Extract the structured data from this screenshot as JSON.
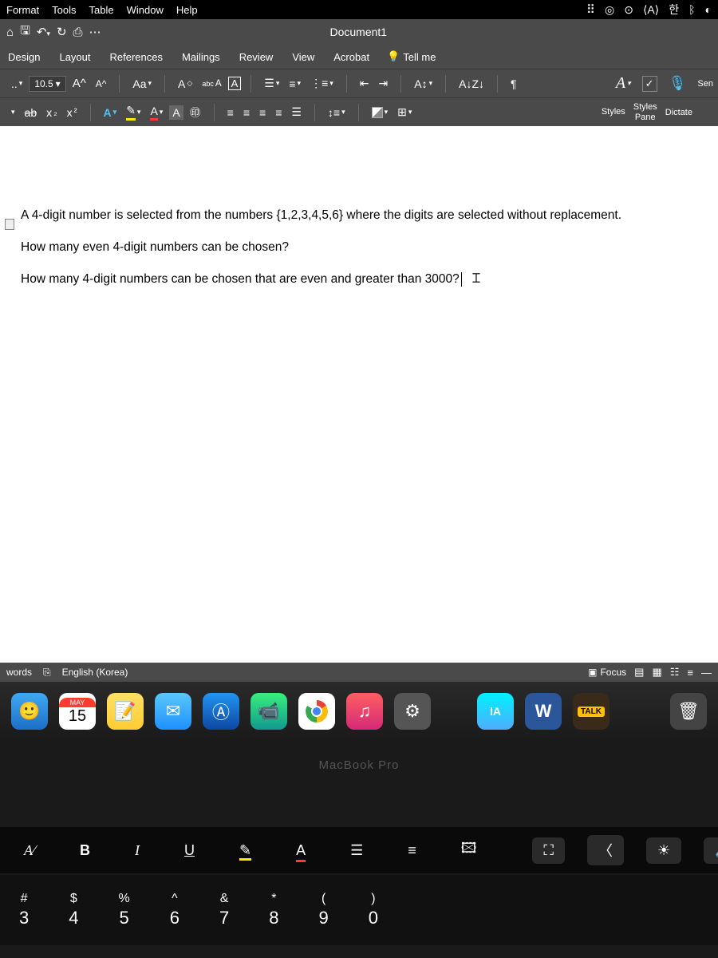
{
  "mac_menu": {
    "items": [
      "Format",
      "Tools",
      "Table",
      "Window",
      "Help"
    ]
  },
  "titlebar": {
    "title": "Document1"
  },
  "ribbon_tabs": {
    "items": [
      "Design",
      "Layout",
      "References",
      "Mailings",
      "Review",
      "View",
      "Acrobat"
    ],
    "tell_me": "Tell me"
  },
  "ribbon": {
    "font_size": "10.5",
    "case_label": "Aa",
    "phonetic_label": "abc",
    "styles_label": "Styles",
    "styles_pane_label": "Styles\nPane",
    "dictate_label": "Dictate",
    "sensitivity_label": "Sen"
  },
  "document": {
    "p1": "A 4-digit number is selected from the numbers {1,2,3,4,5,6} where the digits are selected without replacement.",
    "p2": "How many even 4-digit numbers can be chosen?",
    "p3": "How many 4-digit numbers can be chosen that are even and greater than 3000?"
  },
  "statusbar": {
    "words": "words",
    "language": "English (Korea)",
    "focus": "Focus"
  },
  "dock": {
    "cal_month": "MAY",
    "cal_day": "15",
    "word_letter": "W",
    "talk_badge": "TALK",
    "la_label": "lA"
  },
  "laptop": {
    "label": "MacBook Pro"
  },
  "touchbar": {
    "bold": "B",
    "italic": "I",
    "underline": "U",
    "fontA": "A"
  },
  "keys": [
    {
      "sym": "#",
      "num": "3"
    },
    {
      "sym": "$",
      "num": "4"
    },
    {
      "sym": "%",
      "num": "5"
    },
    {
      "sym": "^",
      "num": "6"
    },
    {
      "sym": "&",
      "num": "7"
    },
    {
      "sym": "*",
      "num": "8"
    },
    {
      "sym": "(",
      "num": "9"
    },
    {
      "sym": ")",
      "num": "0"
    }
  ]
}
